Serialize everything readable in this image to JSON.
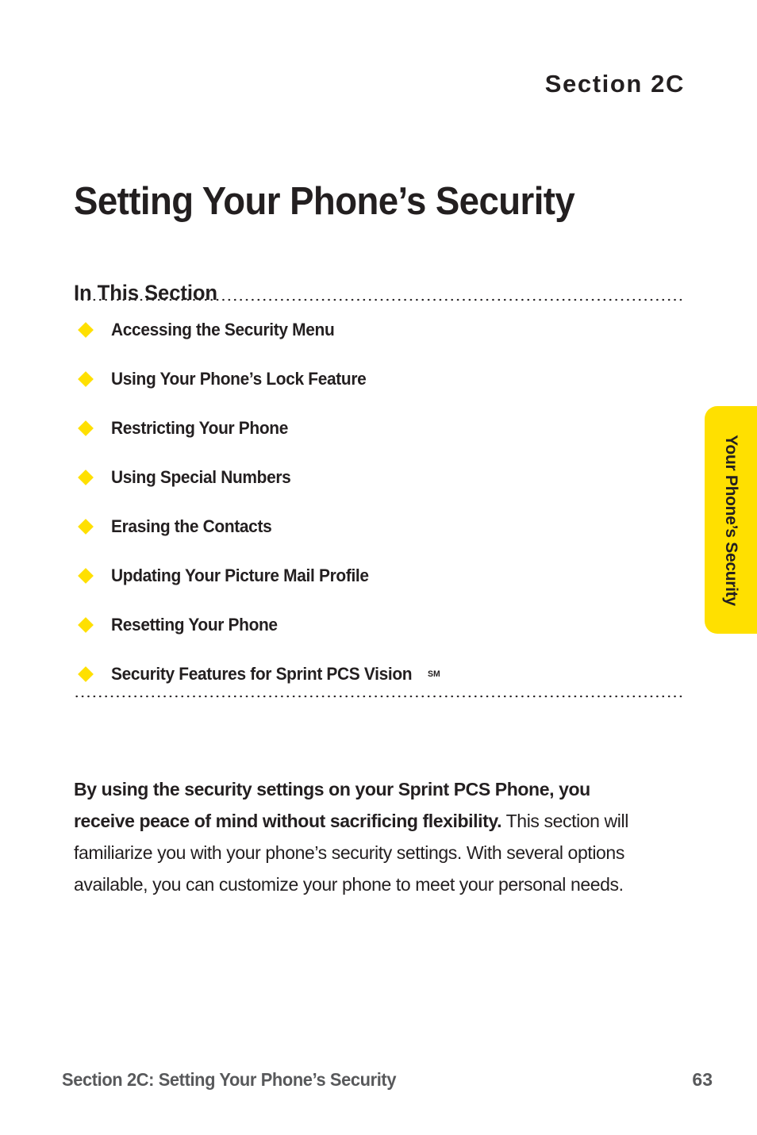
{
  "page": {
    "background_color": "#ffffff",
    "accent_color": "#ffe000",
    "text_color": "#231f20",
    "footer_color": "#58595b"
  },
  "header": {
    "section_eyebrow": "Section 2C",
    "title": "Setting Your Phone’s Security"
  },
  "in_this_section": {
    "heading": "In This Section",
    "items": [
      {
        "label": "Accessing the Security Menu",
        "suffix": ""
      },
      {
        "label": "Using Your Phone’s Lock Feature",
        "suffix": ""
      },
      {
        "label": "Restricting Your Phone",
        "suffix": ""
      },
      {
        "label": "Using Special Numbers",
        "suffix": ""
      },
      {
        "label": "Erasing the Contacts",
        "suffix": ""
      },
      {
        "label": "Updating Your Picture Mail Profile",
        "suffix": ""
      },
      {
        "label": "Resetting Your Phone",
        "suffix": ""
      },
      {
        "label": "Security Features for Sprint PCS Vision",
        "suffix": "SM"
      }
    ]
  },
  "body": {
    "lead": "By using the security settings on your Sprint PCS Phone, you receive peace of mind without sacrificing flexibility.",
    "rest": " This section will familiarize you with your phone’s security settings. With several options available, you can customize your phone to meet your personal needs."
  },
  "side_tab": {
    "label": "Your Phone’s Security"
  },
  "footer": {
    "text": "Section 2C: Setting Your Phone’s Security",
    "page_number": "63"
  }
}
